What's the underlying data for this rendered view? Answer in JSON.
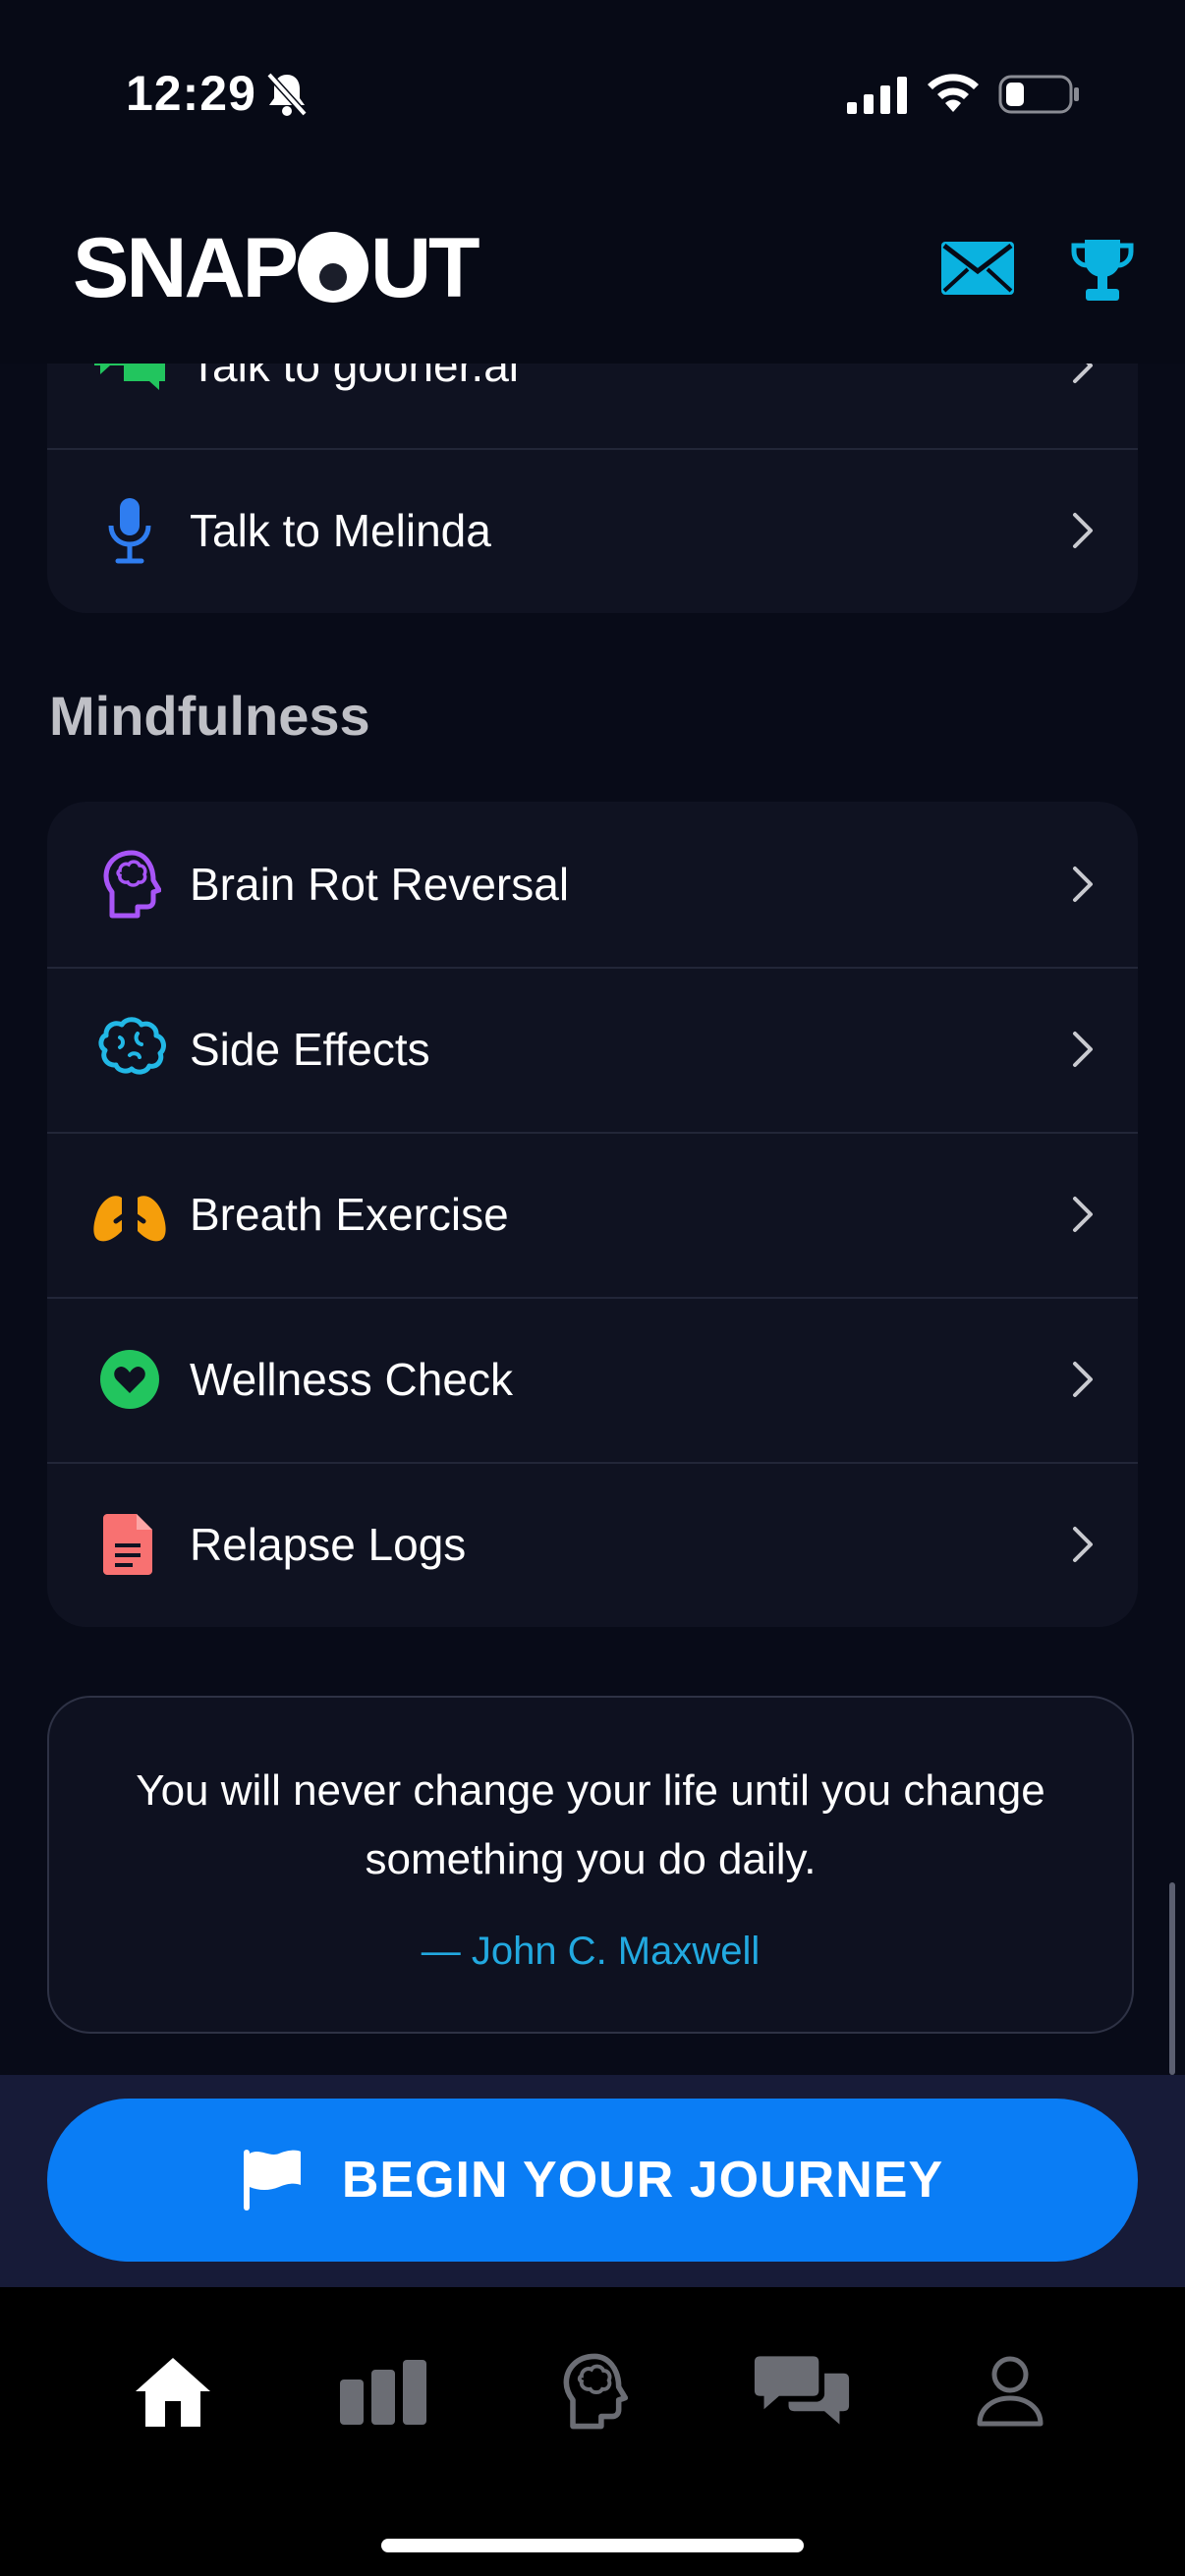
{
  "status_bar": {
    "time": "12:29"
  },
  "header": {
    "brand": "SNAPOUT"
  },
  "support_list": {
    "items": [
      {
        "label": "Talk to gooner.ai",
        "icon": "chat-bubbles-icon"
      },
      {
        "label": "Talk to Melinda",
        "icon": "microphone-icon"
      }
    ]
  },
  "mindfulness": {
    "title": "Mindfulness",
    "items": [
      {
        "label": "Brain Rot Reversal",
        "icon": "head-brain-icon",
        "color": "#a855f7"
      },
      {
        "label": "Side Effects",
        "icon": "brain-icon",
        "color": "#22b8e6"
      },
      {
        "label": "Breath Exercise",
        "icon": "lungs-icon",
        "color": "#f59e0b"
      },
      {
        "label": "Wellness Check",
        "icon": "heart-circle-icon",
        "color": "#22c55e"
      },
      {
        "label": "Relapse Logs",
        "icon": "document-icon",
        "color": "#f87171"
      }
    ]
  },
  "quote": {
    "text": "You will never change your life until you change something you do daily.",
    "author": "— John C. Maxwell"
  },
  "cta": {
    "label": "BEGIN YOUR JOURNEY"
  },
  "tabs": [
    {
      "name": "home",
      "icon": "home-icon"
    },
    {
      "name": "stats",
      "icon": "bar-chart-icon"
    },
    {
      "name": "mind",
      "icon": "head-brain-icon"
    },
    {
      "name": "chat",
      "icon": "chat-bubbles-icon"
    },
    {
      "name": "profile",
      "icon": "person-icon"
    }
  ],
  "colors": {
    "accent": "#0a7df5",
    "icon_blue": "#0ab2e0",
    "background": "#080b18"
  }
}
